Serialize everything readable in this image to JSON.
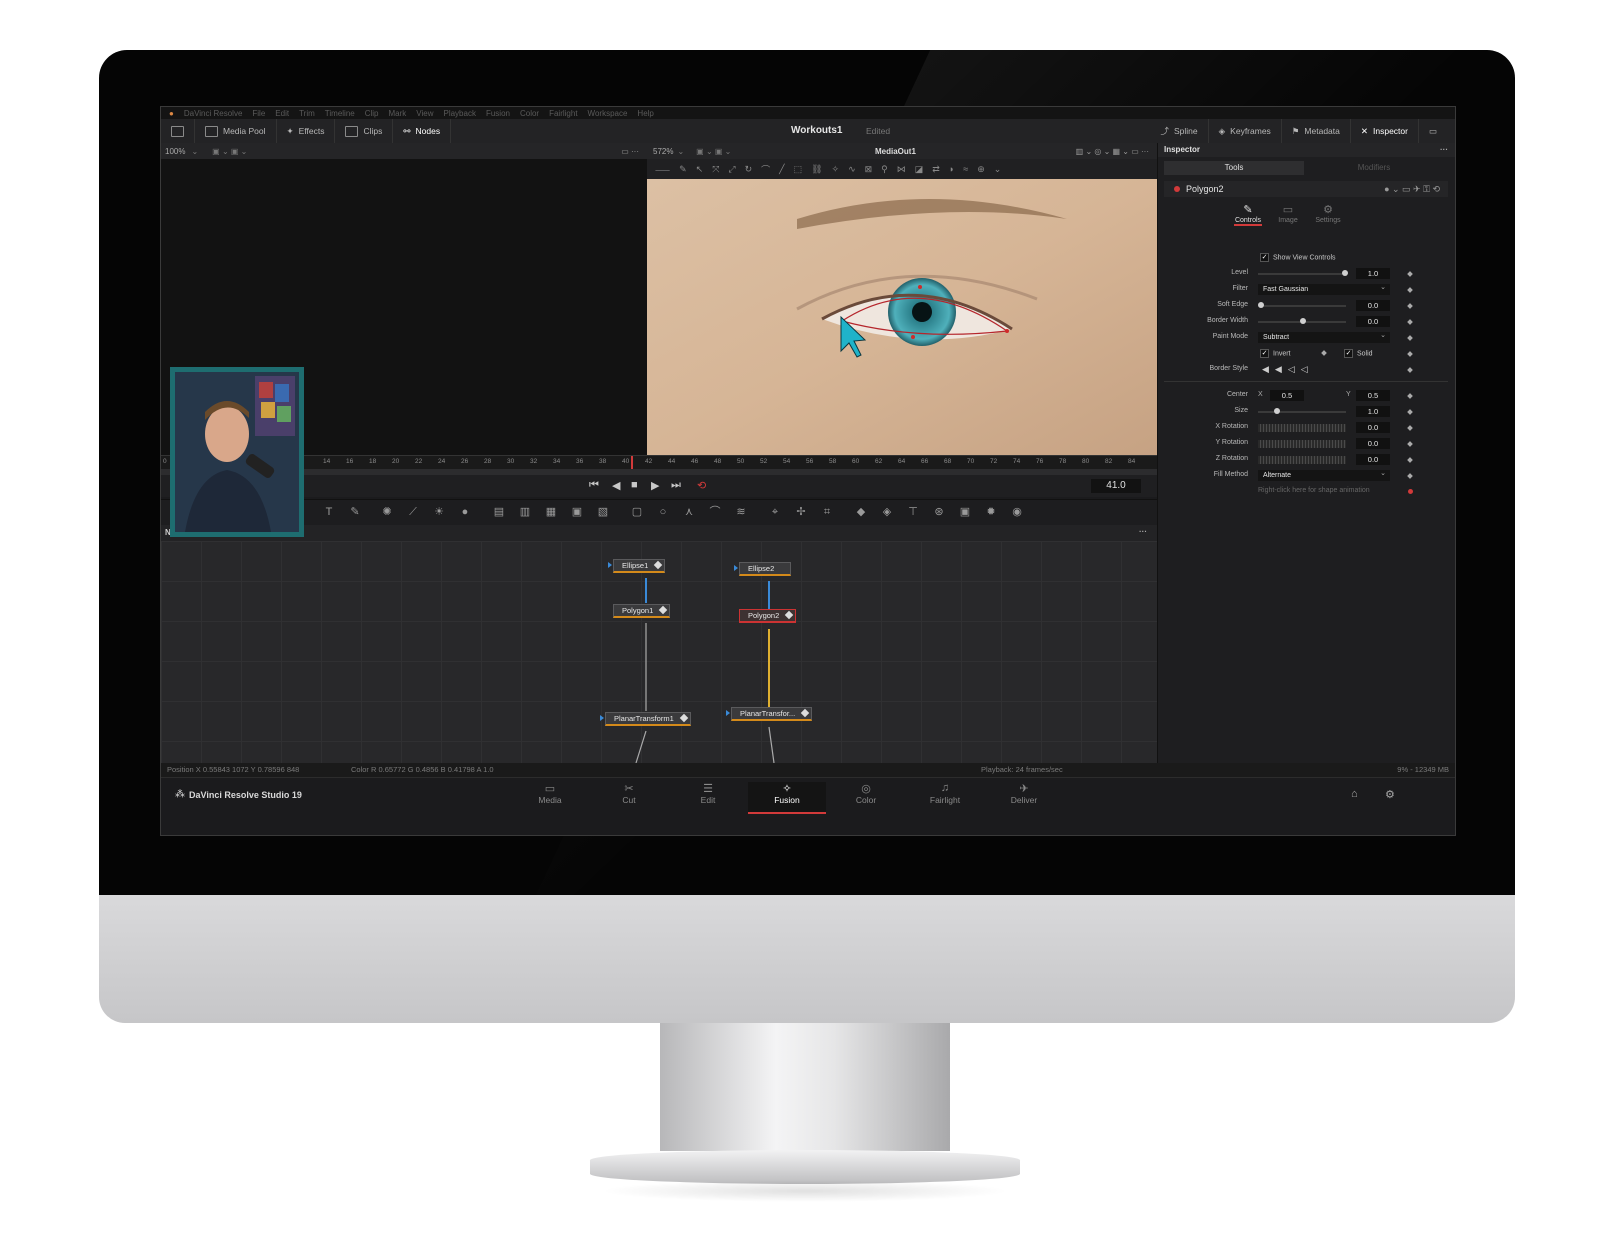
{
  "app": {
    "menus": [
      "DaVinci Resolve",
      "File",
      "Edit",
      "Trim",
      "Timeline",
      "Clip",
      "Mark",
      "View",
      "Playback",
      "Fusion",
      "Color",
      "Fairlight",
      "Workspace",
      "Help"
    ],
    "project_title": "Workouts1",
    "project_status": "Edited"
  },
  "toolbar": {
    "left": [
      {
        "label": "Media Pool",
        "icon": "media-pool-icon"
      },
      {
        "label": "Effects",
        "icon": "effects-icon"
      },
      {
        "label": "Clips",
        "icon": "clips-icon"
      },
      {
        "label": "Nodes",
        "icon": "nodes-icon"
      }
    ],
    "right": [
      {
        "label": "Spline",
        "icon": "spline-icon"
      },
      {
        "label": "Keyframes",
        "icon": "keyframes-icon"
      },
      {
        "label": "Metadata",
        "icon": "metadata-icon"
      },
      {
        "label": "Inspector",
        "icon": "inspector-icon"
      }
    ]
  },
  "viewer": {
    "left_zoom": "100%",
    "right_zoom": "572%",
    "right_title": "MediaOut1",
    "timecode": "41.0",
    "ruler_ticks": [
      "0",
      "14",
      "16",
      "18",
      "20",
      "22",
      "24",
      "26",
      "28",
      "30",
      "32",
      "34",
      "36",
      "38",
      "40",
      "42",
      "44",
      "46",
      "48",
      "50",
      "52",
      "54",
      "56",
      "58",
      "60",
      "62",
      "64",
      "66",
      "68",
      "70",
      "72",
      "74",
      "76",
      "78",
      "80",
      "82",
      "84"
    ]
  },
  "nodes": {
    "panel_title": "Nodes",
    "items": [
      "Ellipse1",
      "Polygon1",
      "PlanarTransform1",
      "Ellipse2",
      "Polygon2",
      "PlanarTransfor..."
    ]
  },
  "inspector": {
    "title": "Inspector",
    "tabs": [
      "Tools",
      "Modifiers"
    ],
    "tool_name": "Polygon2",
    "subtabs": [
      "Controls",
      "Image",
      "Settings"
    ],
    "show_view_controls": "Show View Controls",
    "params": {
      "level": {
        "label": "Level",
        "value": "1.0"
      },
      "filter": {
        "label": "Filter",
        "value": "Fast Gaussian"
      },
      "soft_edge": {
        "label": "Soft Edge",
        "value": "0.0"
      },
      "border_width": {
        "label": "Border Width",
        "value": "0.0"
      },
      "paint_mode": {
        "label": "Paint Mode",
        "value": "Subtract"
      },
      "invert": "Invert",
      "solid": "Solid",
      "border_style": {
        "label": "Border Style"
      },
      "center": {
        "label": "Center",
        "x_label": "X",
        "x": "0.5",
        "y_label": "Y",
        "y": "0.5"
      },
      "size": {
        "label": "Size",
        "value": "1.0"
      },
      "x_rotation": {
        "label": "X Rotation",
        "value": "0.0"
      },
      "y_rotation": {
        "label": "Y Rotation",
        "value": "0.0"
      },
      "z_rotation": {
        "label": "Z Rotation",
        "value": "0.0"
      },
      "fill_method": {
        "label": "Fill Method",
        "value": "Alternate"
      }
    },
    "hint": "Right-click here for shape animation"
  },
  "status": {
    "position": "Position  X 0.55843    1072   Y 0.78596    848",
    "color": "Color R 0.65772   G 0.4856    B 0.41798   A 1.0",
    "playback": "Playback: 24 frames/sec",
    "memory": "9% - 12349 MB"
  },
  "pages": {
    "brand": "DaVinci Resolve Studio 19",
    "items": [
      "Media",
      "Cut",
      "Edit",
      "Fusion",
      "Color",
      "Fairlight",
      "Deliver"
    ],
    "active": "Fusion"
  },
  "colors": {
    "accent_red": "#d23a3a",
    "node_link_yellow": "#e0b030",
    "node_link_blue": "#3a8ad8",
    "pip_border": "#1e6d70"
  }
}
